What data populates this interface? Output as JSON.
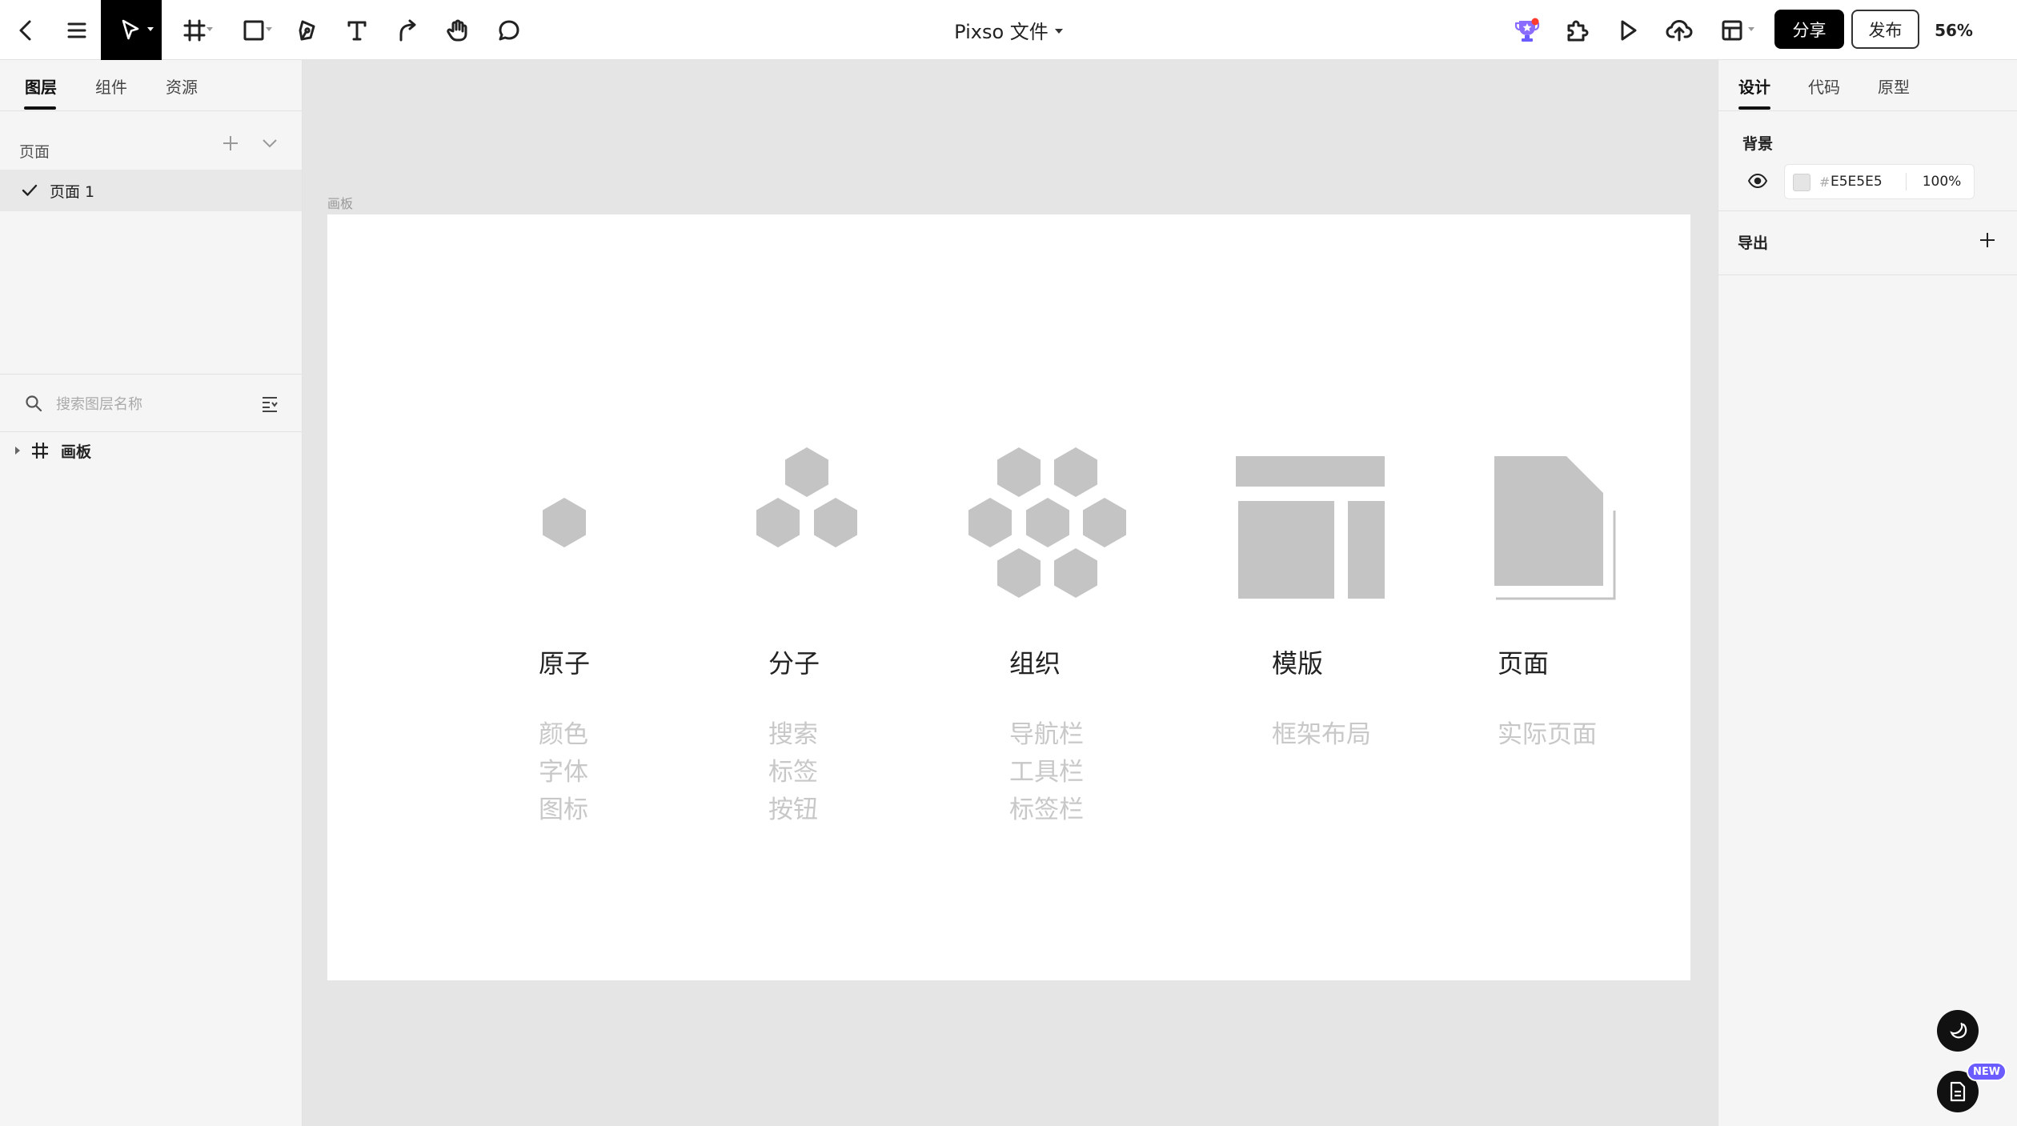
{
  "toolbar": {
    "doc_title": "Pixso 文件",
    "share_label": "分享",
    "publish_label": "发布",
    "zoom": "56%",
    "icons": [
      "back-icon",
      "menu-icon",
      "move-tool-icon",
      "frame-tool-icon",
      "rectangle-tool-icon",
      "pen-tool-icon",
      "text-tool-icon",
      "connector-tool-icon",
      "hand-tool-icon",
      "comment-tool-icon",
      "trophy-icon",
      "plugin-icon",
      "play-icon",
      "upload-icon",
      "layout-icon"
    ]
  },
  "left_panel": {
    "tabs": [
      {
        "label": "图层",
        "active": true
      },
      {
        "label": "组件",
        "active": false
      },
      {
        "label": "资源",
        "active": false
      }
    ],
    "pages_header": "页面",
    "pages": [
      {
        "label": "页面 1",
        "selected": true
      }
    ],
    "search_placeholder": "搜索图层名称",
    "layers": [
      {
        "label": "画板",
        "type": "frame"
      }
    ]
  },
  "canvas": {
    "frame_label": "画板",
    "background": "#E5E5E5",
    "columns": [
      {
        "title": "原子",
        "items": [
          "颜色",
          "字体",
          "图标"
        ]
      },
      {
        "title": "分子",
        "items": [
          "搜索",
          "标签",
          "按钮"
        ]
      },
      {
        "title": "组织",
        "items": [
          "导航栏",
          "工具栏",
          "标签栏"
        ]
      },
      {
        "title": "模版",
        "items": [
          "框架布局"
        ]
      },
      {
        "title": "页面",
        "items": [
          "实际页面"
        ]
      }
    ]
  },
  "right_panel": {
    "tabs": [
      {
        "label": "设计",
        "active": true
      },
      {
        "label": "代码",
        "active": false
      },
      {
        "label": "原型",
        "active": false
      }
    ],
    "background_label": "背景",
    "background_hash": "#",
    "background_hex": "E5E5E5",
    "background_opacity": "100%",
    "export_label": "导出"
  },
  "floating": {
    "new_badge": "NEW"
  },
  "colors": {
    "accent": "#000000",
    "shape_gray": "#c4c4c4",
    "badge": "#6b5cff",
    "notification": "#ff3b30"
  }
}
